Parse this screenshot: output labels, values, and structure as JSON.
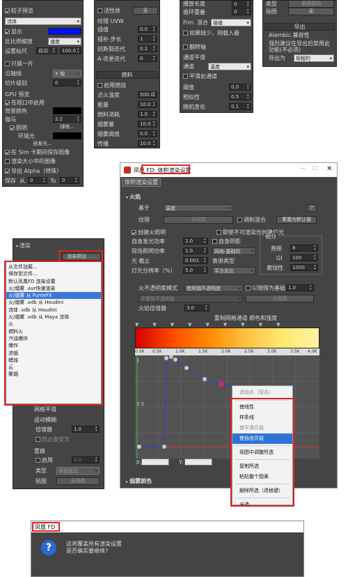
{
  "p1": {
    "particle_preview": "粒子预览",
    "mode": "流体",
    "show": "显示",
    "ratio_label": "比比例缩放",
    "ratio_val": "速度",
    "set_label": "设置标尺",
    "set_val": "自动",
    "set_num": "100.0",
    "one_frame": "只展一片",
    "axis_label": "沿轴线",
    "axis_val": "X 轴",
    "slice_label": "切片级别",
    "slice_val": "0",
    "gpu_title": "GPU 预览",
    "gpu_enable": "在视口中启用",
    "bg_label": "背景颜色",
    "gamma_label": "伽马",
    "gamma_val": "2.2",
    "lighting": "照明",
    "exclude": "排除...",
    "env_light": "环境光",
    "auto_light": "自发光...",
    "save_sim": "在 Sim 卡期间保存图像",
    "render_viewport": "渲染大小中的图像",
    "export_alpha": "导出 Alpha（特殊）",
    "save_label": "保存",
    "from_label": "从",
    "from_val": "0",
    "to_label": "To",
    "to_val": "0"
  },
  "p2": {
    "active": "活性体",
    "active_val": "无",
    "tex_title": "纹理 UVW",
    "blend": "插值",
    "blend_val": "0.0",
    "jitter": "插补·步长",
    "jitter_val": "1",
    "anti": "抗断裂迭代",
    "anti_val": "0.1",
    "a_iter": "A-迭更迭代",
    "a_iter_val": "0",
    "fuel_title": "燃料",
    "enable_fuel": "启用燃烧",
    "ign": "点火温度",
    "ign_val": "500.0",
    "energy": "能量",
    "energy_val": "10.0",
    "burn": "燃料消耗",
    "burn_val": "1.0",
    "smoke": "烟雾量",
    "smoke_val": "10.0",
    "smoke_th": "烟雾阈值",
    "smoke_th_val": "0.0",
    "expand": "传播",
    "expand_val": "10.0"
  },
  "p3": {
    "play_len": "播放长度",
    "play_len_val": "0",
    "loop": "循环重叠",
    "loop_val": "0",
    "frm": "Frm. 混合",
    "frm_val": "插值",
    "if_missing": "如果缺少，则载入最",
    "flip": "翻转轴",
    "smooth_title": "通道平滑",
    "channel": "通道",
    "channel_val": "温度",
    "smooth_chk": "平滑此通道",
    "threshold": "阈值",
    "threshold_val": "0.0",
    "similarity": "相似性",
    "similarity_val": "0.5",
    "random": "随机变化",
    "random_val": "0.1"
  },
  "p4": {
    "type_label": "类型",
    "type_val": "表面驱动",
    "map_label": "贴图",
    "map_val": "无",
    "export_title": "导出",
    "alembic": "Alembic 兼容性",
    "note": "强烈建议在导出后禁用此功能(不必须)",
    "export_as": "导出为",
    "export_as_val": "规程的"
  },
  "render_panel": {
    "title": "渲染",
    "preset_btn": "渲染预设 . . .",
    "menu": [
      "从文件加载...",
      "保存到文件...",
      "默认凤凰FD 渲染设置",
      "火/烟雾 .aur快速渲染",
      "火/烟雾 从 FumeFX",
      "火/烟雾 .vdb 从 Houdini",
      "流体 .vdb 从 Houdini",
      "火/烟雾 .vdb 从 Maya 流体",
      "火",
      "燃料火",
      "汽油爆炸",
      "爆炸",
      "浓烟",
      "蜡烛",
      "云",
      "雾烟"
    ],
    "selected": 4,
    "smooth": "网格平滑",
    "motion_blur": "运动模糊",
    "mult": "倍增器",
    "mult_val": "1.0",
    "prevent": "防止自交叉",
    "displace": "置换",
    "enable": "启用",
    "enable_val": "1.0",
    "type": "类型",
    "type_val": "表面驱动",
    "map": "贴图",
    "map_val": "无贴图"
  },
  "dialog": {
    "title": "凤凰 FD: 体积渲染设置",
    "tab": "体积渲染设置",
    "section": "火焰",
    "base": "基于",
    "base_val": "温度",
    "texture": "纹理",
    "texture_val": "无贴图",
    "mod_mix": "调制混合",
    "reset": "重置为默认值",
    "create_light": "创建火照明",
    "block_light": "即使不可渲染也创建灯光",
    "power": "自身发光功率",
    "power_val": "1.0",
    "shadow": "自身阴影",
    "scene_power": "现场照明功率",
    "scene_power_val": "1.0",
    "grid_based": "网格-基础的",
    "light_cut": "光 截止",
    "light_cut_val": "0.001",
    "decay": "衰退类型",
    "lod": "灯光分辨率（%）",
    "lod_val": "5.0",
    "inv_sq": "平方反比",
    "subdiv": "细分",
    "direct": "直接",
    "direct_val": "8",
    "gi": "GI",
    "gi_val": "100",
    "shadow_sub": "腐蚀性",
    "shadow_sub_val": "1000",
    "opacity_mode": "火不透明度模式",
    "opacity_mode_val": "使用烟不透明度",
    "phys": "以物理为基础",
    "phys_val": "1.0",
    "opacity_sub": "不使用不透明度",
    "opacity_map": "无贴图",
    "fire_mult": "火焰倍增器",
    "fire_mult_val": "3.0",
    "grad_title": "重制网格通道 颜色和强度",
    "ticks": [
      "0.0K",
      "0.5K",
      "1.0K",
      "1.5K",
      "2.0K",
      "2.5K",
      "3.0K",
      "3.5K",
      "4.0K"
    ],
    "y1": "1",
    "y05": "0.5",
    "x_label": "X:",
    "y_label": "Y:",
    "smoke_section": "烟雾颜色"
  },
  "ctx": {
    "add": "添加点（双击）",
    "linear": "使线性",
    "spline": "样条线",
    "smooth_bezier": "使平滑贝兹",
    "free_bezier": "使自由贝兹",
    "view_adjust": "视图中调整所选",
    "copy": "复制所选",
    "paste": "粘贴整个图表",
    "delete": "删除所选（退格键）",
    "select_all": "全选"
  },
  "confirm": {
    "title": "凤凰 FD",
    "line1": "这将覆盖所有渲染设置",
    "line2": "是否确实要继续?"
  },
  "colors": {
    "gradient": [
      "#d40000",
      "#ff4a00",
      "#ff8a00",
      "#ffc040",
      "#ffe870",
      "#fff3a0"
    ]
  }
}
